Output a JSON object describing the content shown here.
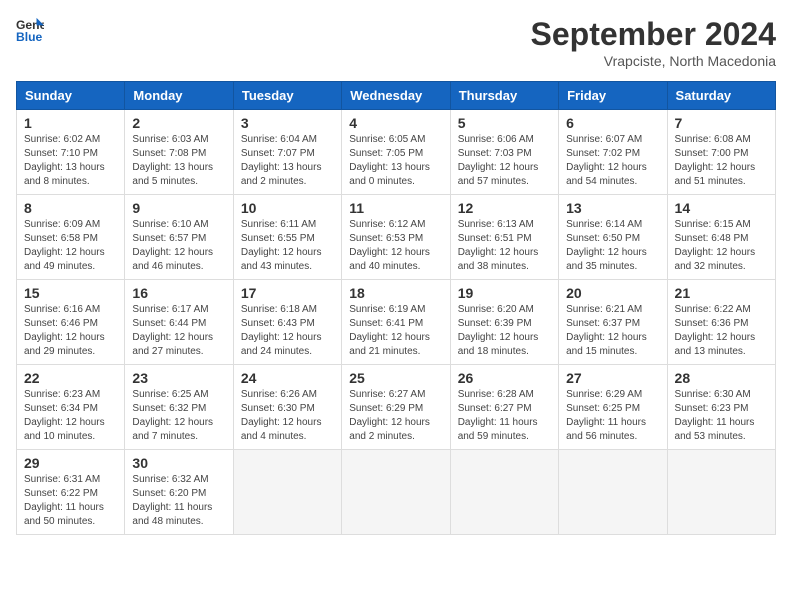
{
  "header": {
    "logo_line1": "General",
    "logo_line2": "Blue",
    "month_title": "September 2024",
    "location": "Vrapciste, North Macedonia"
  },
  "weekdays": [
    "Sunday",
    "Monday",
    "Tuesday",
    "Wednesday",
    "Thursday",
    "Friday",
    "Saturday"
  ],
  "weeks": [
    [
      {
        "day": "1",
        "sunrise": "6:02 AM",
        "sunset": "7:10 PM",
        "daylight": "13 hours and 8 minutes."
      },
      {
        "day": "2",
        "sunrise": "6:03 AM",
        "sunset": "7:08 PM",
        "daylight": "13 hours and 5 minutes."
      },
      {
        "day": "3",
        "sunrise": "6:04 AM",
        "sunset": "7:07 PM",
        "daylight": "13 hours and 2 minutes."
      },
      {
        "day": "4",
        "sunrise": "6:05 AM",
        "sunset": "7:05 PM",
        "daylight": "13 hours and 0 minutes."
      },
      {
        "day": "5",
        "sunrise": "6:06 AM",
        "sunset": "7:03 PM",
        "daylight": "12 hours and 57 minutes."
      },
      {
        "day": "6",
        "sunrise": "6:07 AM",
        "sunset": "7:02 PM",
        "daylight": "12 hours and 54 minutes."
      },
      {
        "day": "7",
        "sunrise": "6:08 AM",
        "sunset": "7:00 PM",
        "daylight": "12 hours and 51 minutes."
      }
    ],
    [
      {
        "day": "8",
        "sunrise": "6:09 AM",
        "sunset": "6:58 PM",
        "daylight": "12 hours and 49 minutes."
      },
      {
        "day": "9",
        "sunrise": "6:10 AM",
        "sunset": "6:57 PM",
        "daylight": "12 hours and 46 minutes."
      },
      {
        "day": "10",
        "sunrise": "6:11 AM",
        "sunset": "6:55 PM",
        "daylight": "12 hours and 43 minutes."
      },
      {
        "day": "11",
        "sunrise": "6:12 AM",
        "sunset": "6:53 PM",
        "daylight": "12 hours and 40 minutes."
      },
      {
        "day": "12",
        "sunrise": "6:13 AM",
        "sunset": "6:51 PM",
        "daylight": "12 hours and 38 minutes."
      },
      {
        "day": "13",
        "sunrise": "6:14 AM",
        "sunset": "6:50 PM",
        "daylight": "12 hours and 35 minutes."
      },
      {
        "day": "14",
        "sunrise": "6:15 AM",
        "sunset": "6:48 PM",
        "daylight": "12 hours and 32 minutes."
      }
    ],
    [
      {
        "day": "15",
        "sunrise": "6:16 AM",
        "sunset": "6:46 PM",
        "daylight": "12 hours and 29 minutes."
      },
      {
        "day": "16",
        "sunrise": "6:17 AM",
        "sunset": "6:44 PM",
        "daylight": "12 hours and 27 minutes."
      },
      {
        "day": "17",
        "sunrise": "6:18 AM",
        "sunset": "6:43 PM",
        "daylight": "12 hours and 24 minutes."
      },
      {
        "day": "18",
        "sunrise": "6:19 AM",
        "sunset": "6:41 PM",
        "daylight": "12 hours and 21 minutes."
      },
      {
        "day": "19",
        "sunrise": "6:20 AM",
        "sunset": "6:39 PM",
        "daylight": "12 hours and 18 minutes."
      },
      {
        "day": "20",
        "sunrise": "6:21 AM",
        "sunset": "6:37 PM",
        "daylight": "12 hours and 15 minutes."
      },
      {
        "day": "21",
        "sunrise": "6:22 AM",
        "sunset": "6:36 PM",
        "daylight": "12 hours and 13 minutes."
      }
    ],
    [
      {
        "day": "22",
        "sunrise": "6:23 AM",
        "sunset": "6:34 PM",
        "daylight": "12 hours and 10 minutes."
      },
      {
        "day": "23",
        "sunrise": "6:25 AM",
        "sunset": "6:32 PM",
        "daylight": "12 hours and 7 minutes."
      },
      {
        "day": "24",
        "sunrise": "6:26 AM",
        "sunset": "6:30 PM",
        "daylight": "12 hours and 4 minutes."
      },
      {
        "day": "25",
        "sunrise": "6:27 AM",
        "sunset": "6:29 PM",
        "daylight": "12 hours and 2 minutes."
      },
      {
        "day": "26",
        "sunrise": "6:28 AM",
        "sunset": "6:27 PM",
        "daylight": "11 hours and 59 minutes."
      },
      {
        "day": "27",
        "sunrise": "6:29 AM",
        "sunset": "6:25 PM",
        "daylight": "11 hours and 56 minutes."
      },
      {
        "day": "28",
        "sunrise": "6:30 AM",
        "sunset": "6:23 PM",
        "daylight": "11 hours and 53 minutes."
      }
    ],
    [
      {
        "day": "29",
        "sunrise": "6:31 AM",
        "sunset": "6:22 PM",
        "daylight": "11 hours and 50 minutes."
      },
      {
        "day": "30",
        "sunrise": "6:32 AM",
        "sunset": "6:20 PM",
        "daylight": "11 hours and 48 minutes."
      },
      null,
      null,
      null,
      null,
      null
    ]
  ]
}
